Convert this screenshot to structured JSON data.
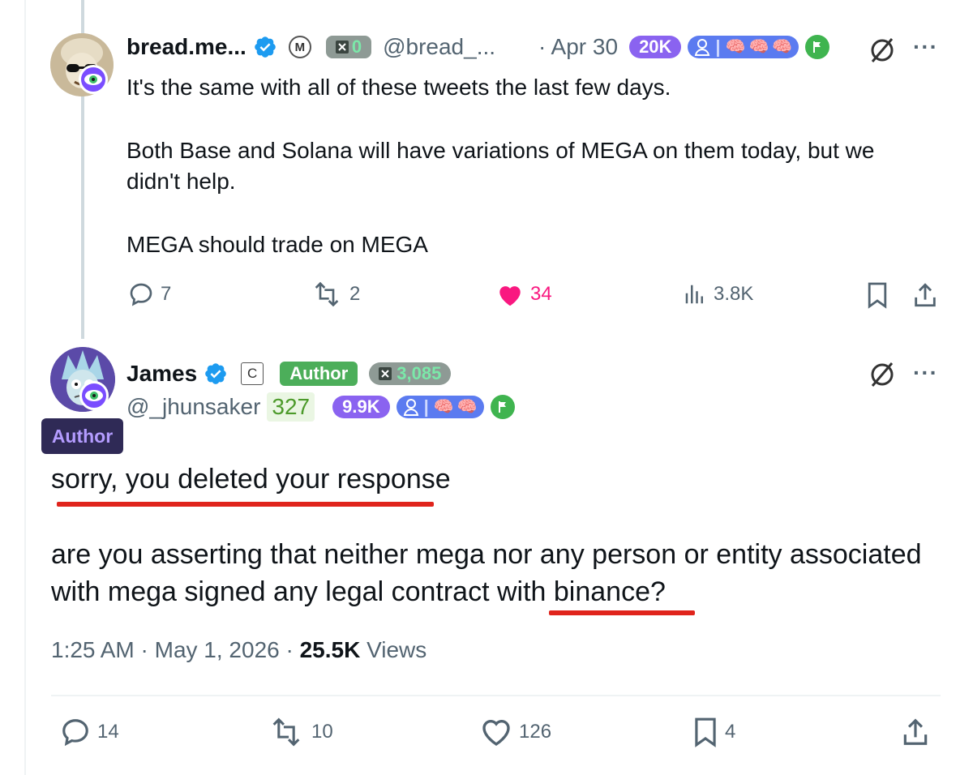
{
  "reply": {
    "display_name": "bread.me...",
    "mini_badge": "M",
    "grey_pill_count": "0",
    "handle": "@bread_...",
    "timestamp": "· Apr 30",
    "followers_pill": "20K",
    "text_lines": [
      "It's the same with all of these tweets the last few days.",
      "Both Base and Solana will have variations of MEGA on them today, but we",
      "didn't help.",
      "MEGA should trade on MEGA"
    ],
    "actions": {
      "replies": "7",
      "reposts": "2",
      "likes": "34",
      "views": "3.8K"
    }
  },
  "main": {
    "display_name": "James",
    "mini_badge": "C",
    "author_pill": "Author",
    "grey_pill_count": "3,085",
    "handle": "@_jhunsaker",
    "score": "327",
    "followers_pill": "9.9K",
    "author_tag": "Author",
    "text_line_1": "sorry, you deleted your response",
    "text_line_2": "are you asserting that neither mega nor any person or entity associated",
    "text_line_3": "with mega signed any legal contract with binance?",
    "meta": {
      "time_date": "1:25 AM · May 1, 2026 · ",
      "views_count": "25.5K",
      "views_label": " Views"
    },
    "actions": {
      "replies": "14",
      "reposts": "10",
      "likes": "126",
      "bookmarks": "4"
    }
  },
  "icons": [
    "verified-badge-icon",
    "eye-icon",
    "brain-icon",
    "flag-icon",
    "slashed-circle-icon",
    "more-icon",
    "reply-icon",
    "repost-icon",
    "heart-icon",
    "views-icon",
    "bookmark-icon",
    "share-icon"
  ],
  "colors": {
    "accent": "#1d9bf0",
    "like": "#f91880",
    "underline": "#e0241c",
    "purple_pill": "#8a63f0",
    "green": "#4cae5a"
  }
}
